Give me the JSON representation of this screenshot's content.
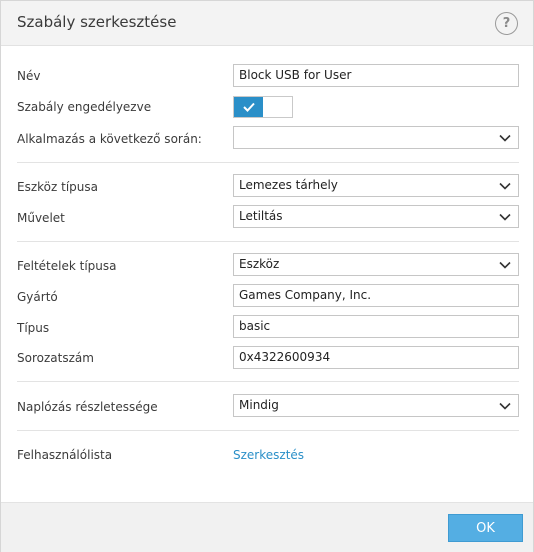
{
  "dialog": {
    "title": "Szabály szerkesztése",
    "help_icon": "question-mark-icon"
  },
  "form": {
    "name": {
      "label": "Név",
      "value": "Block USB for User"
    },
    "enabled": {
      "label": "Szabály engedélyezve",
      "state": true,
      "icon": "checkmark-icon"
    },
    "apply_during": {
      "label": "Alkalmazás a következő során:",
      "value": ""
    },
    "device_type": {
      "label": "Eszköz típusa",
      "value": "Lemezes tárhely"
    },
    "action": {
      "label": "Művelet",
      "value": "Letiltás"
    },
    "criteria_type": {
      "label": "Feltételek típusa",
      "value": "Eszköz"
    },
    "vendor": {
      "label": "Gyártó",
      "value": "Games Company, Inc."
    },
    "model": {
      "label": "Típus",
      "value": "basic"
    },
    "serial": {
      "label": "Sorozatszám",
      "value": "0x4322600934"
    },
    "logging": {
      "label": "Naplózás részletessége",
      "value": "Mindig"
    },
    "user_list": {
      "label": "Felhasználólista",
      "link": "Szerkesztés"
    }
  },
  "footer": {
    "ok_label": "OK"
  },
  "colors": {
    "accent": "#2a8fc8",
    "ok_button": "#54aee3",
    "header_bg": "#f3f3f3"
  }
}
